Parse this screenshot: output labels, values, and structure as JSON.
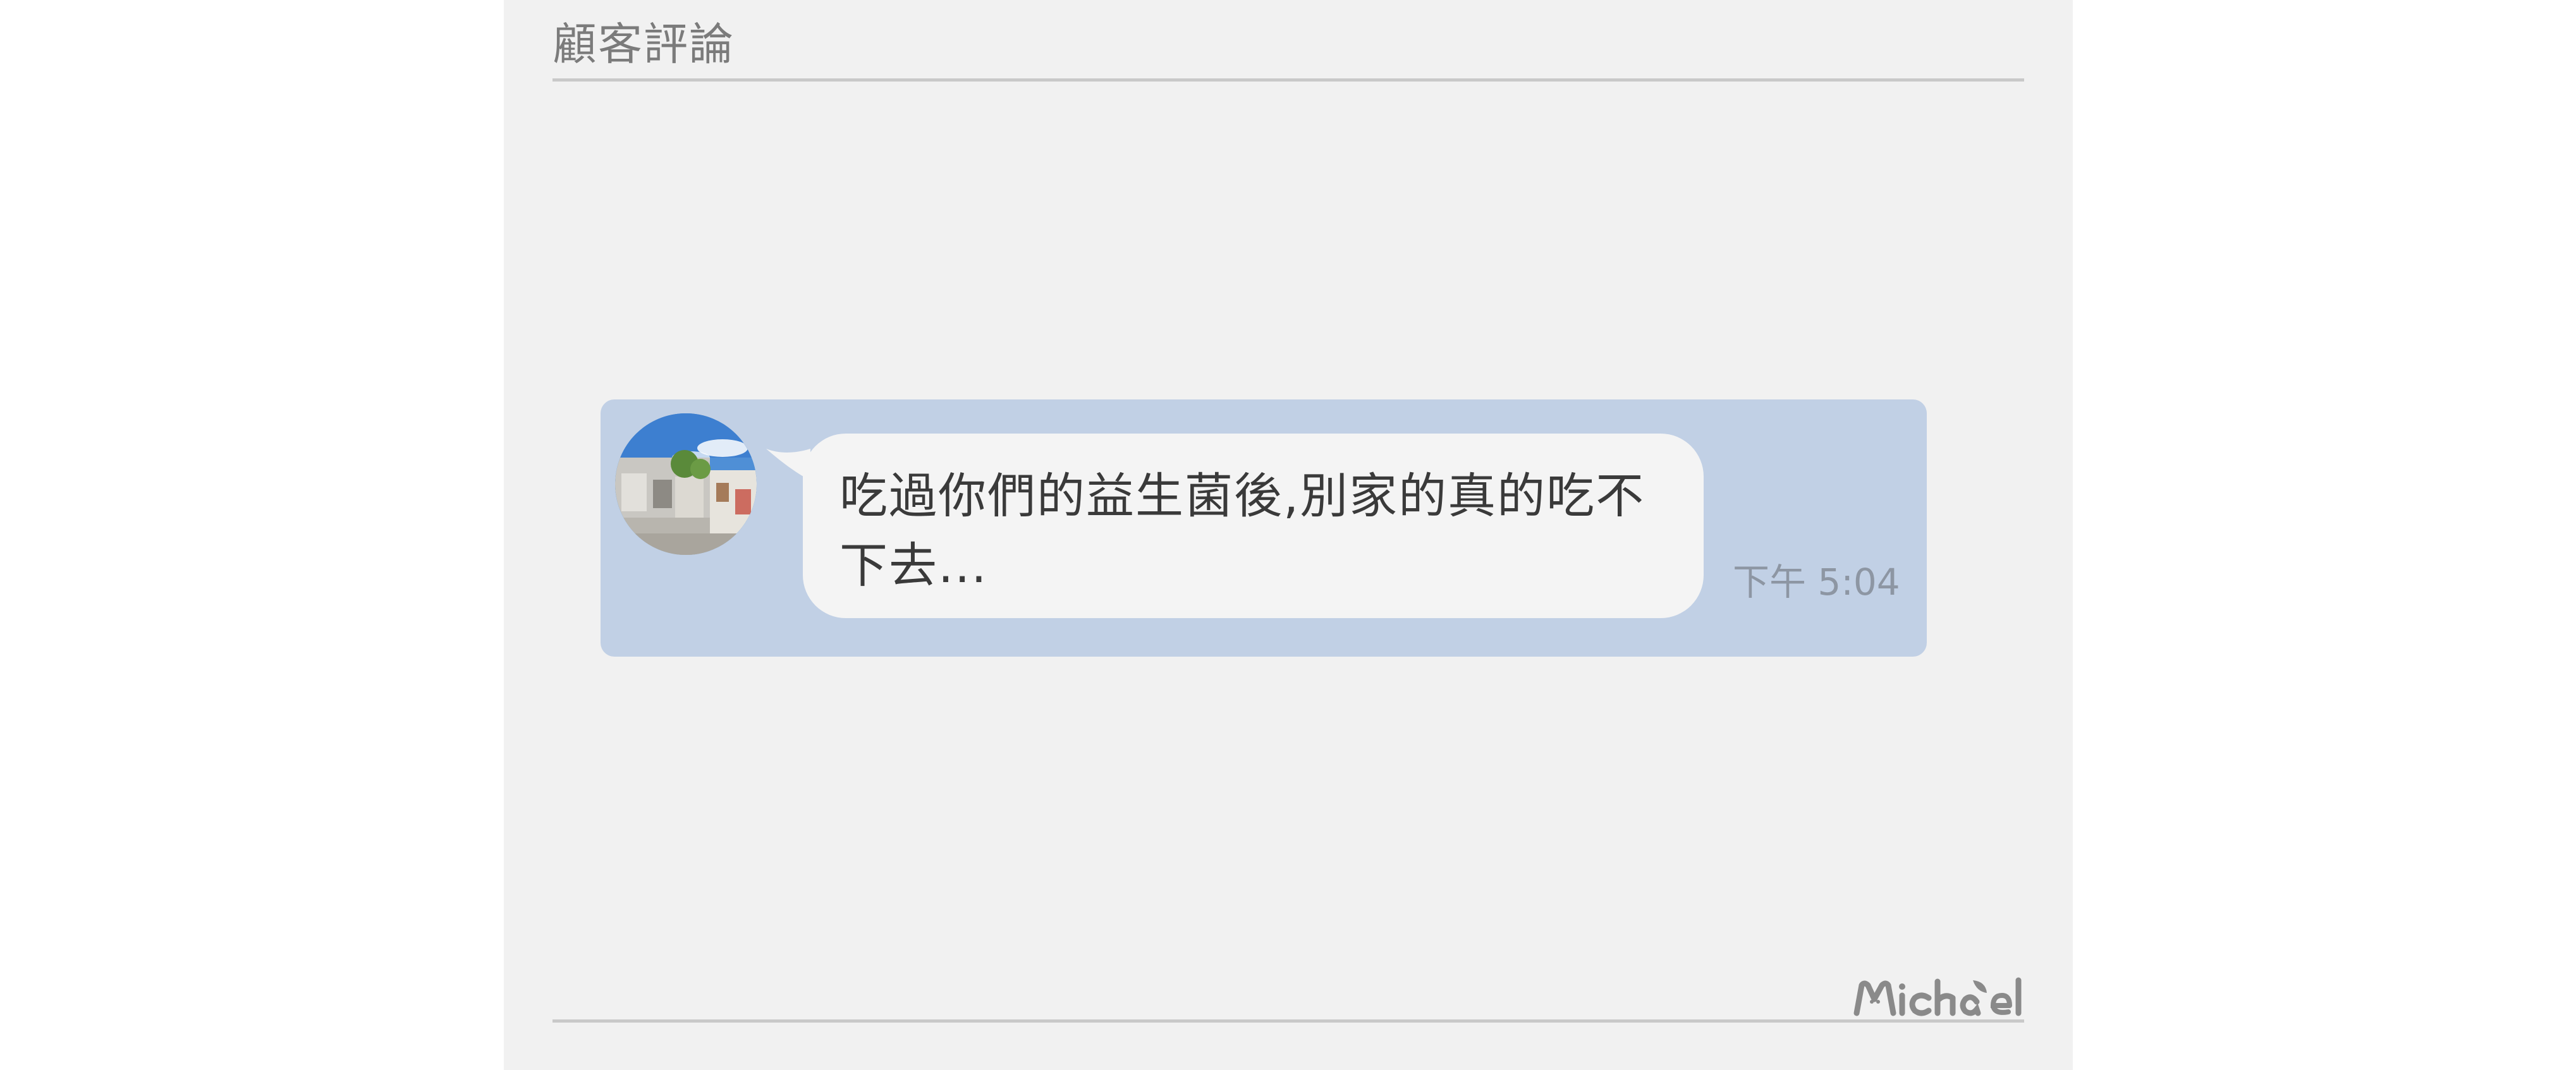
{
  "section": {
    "title": "顧客評論"
  },
  "chat": {
    "message": "吃過你們的益生菌後,別家的真的吃不下去...",
    "time": "下午 5:04",
    "colors": {
      "strip_background": "#c1d0e5",
      "bubble_background": "#f4f4f4",
      "text": "#3a3a3a",
      "time_text": "#8d96a3"
    }
  },
  "avatar": {
    "icon": "profile-photo-street-scene"
  },
  "watermark": {
    "text": "Michael"
  }
}
